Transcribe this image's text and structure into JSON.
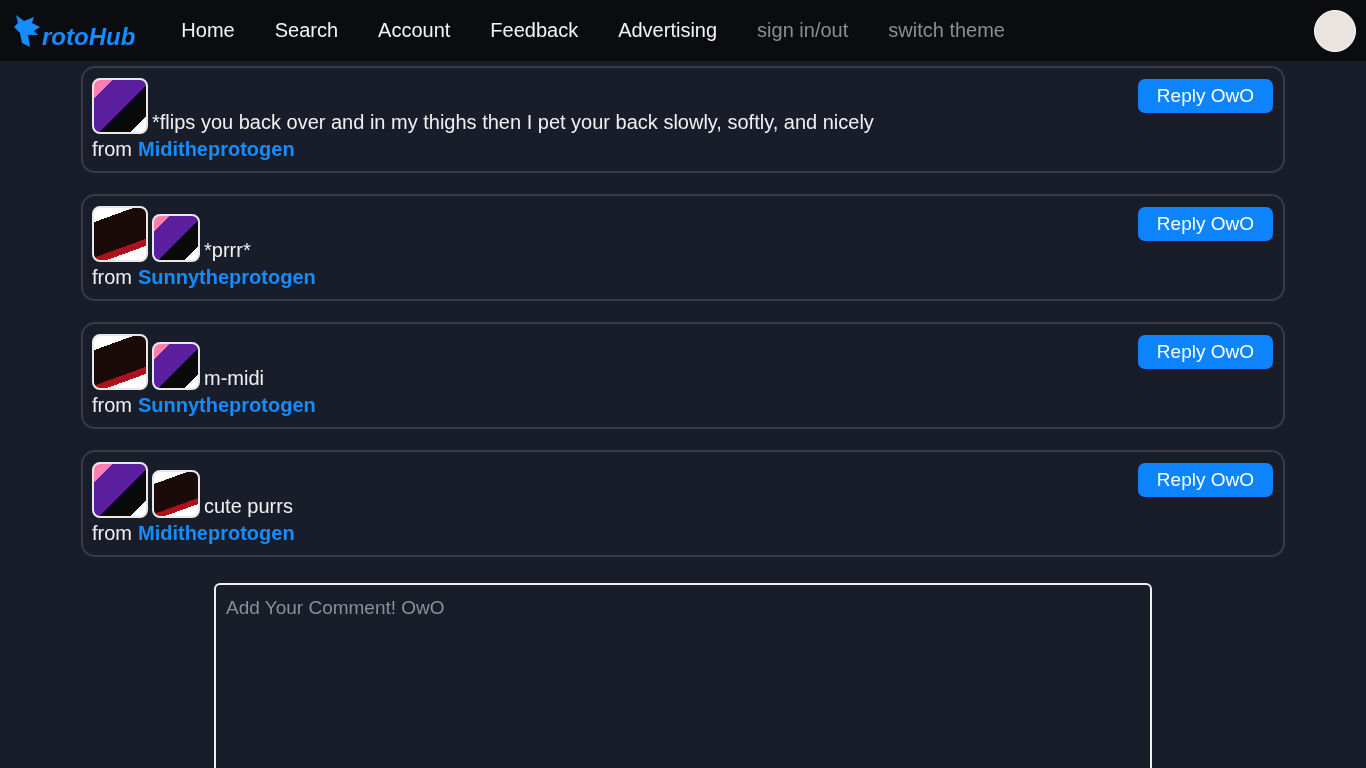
{
  "navbar": {
    "logo_text": "rotoHub",
    "links": [
      {
        "label": "Home",
        "muted": false
      },
      {
        "label": "Search",
        "muted": false
      },
      {
        "label": "Account",
        "muted": false
      },
      {
        "label": "Feedback",
        "muted": false
      },
      {
        "label": "Advertising",
        "muted": false
      },
      {
        "label": "sign in/out",
        "muted": true
      },
      {
        "label": "switch theme",
        "muted": true
      }
    ]
  },
  "comments": [
    {
      "avatars": [
        {
          "kind": "purple"
        }
      ],
      "text": "*flips you back over and in my thighs then I pet your back slowly, softly, and nicely",
      "from_label": "from",
      "author": "Miditheprotogen",
      "reply_button": "Reply OwO"
    },
    {
      "avatars": [
        {
          "kind": "dark"
        },
        {
          "kind": "purple"
        }
      ],
      "text": "*prrr*",
      "from_label": "from",
      "author": "Sunnytheprotogen",
      "reply_button": "Reply OwO"
    },
    {
      "avatars": [
        {
          "kind": "dark"
        },
        {
          "kind": "purple"
        }
      ],
      "text": "m-midi",
      "from_label": "from",
      "author": "Sunnytheprotogen",
      "reply_button": "Reply OwO"
    },
    {
      "avatars": [
        {
          "kind": "purple"
        },
        {
          "kind": "dark"
        }
      ],
      "text": "cute purrs",
      "from_label": "from",
      "author": "Miditheprotogen",
      "reply_button": "Reply OwO"
    }
  ],
  "comment_box": {
    "placeholder": "Add Your Comment! OwO"
  }
}
